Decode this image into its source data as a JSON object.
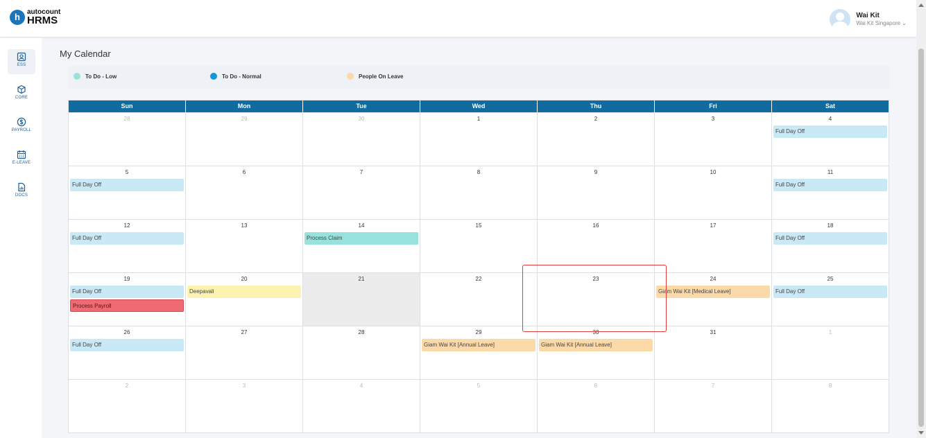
{
  "app": {
    "logo_small": "autocount",
    "logo_big": "HRMS",
    "logo_letter": "h"
  },
  "user": {
    "name": "Wai Kit",
    "company": "Wai Kit Singapore",
    "dropdown_glyph": "⌄"
  },
  "sidebar": {
    "items": [
      {
        "label": "ESS",
        "icon": "ess-icon",
        "active": true
      },
      {
        "label": "CORE",
        "icon": "core-icon",
        "active": false
      },
      {
        "label": "PAYROLL",
        "icon": "payroll-icon",
        "active": false
      },
      {
        "label": "E-LEAVE",
        "icon": "leave-calendar-icon",
        "active": false
      },
      {
        "label": "DOCS",
        "icon": "docs-icon",
        "active": false
      }
    ]
  },
  "page": {
    "title": "My Calendar"
  },
  "legend": [
    {
      "label": "To Do - Low",
      "color": "#97e2dc"
    },
    {
      "label": "To Do - Normal",
      "color": "#1496d6"
    },
    {
      "label": "People On Leave",
      "color": "#fcd9a8"
    }
  ],
  "calendar": {
    "weekdays": [
      "Sun",
      "Mon",
      "Tue",
      "Wed",
      "Thu",
      "Fri",
      "Sat"
    ],
    "weeks": [
      [
        {
          "num": "28",
          "other": true,
          "events": []
        },
        {
          "num": "29",
          "other": true,
          "events": []
        },
        {
          "num": "30",
          "other": true,
          "events": []
        },
        {
          "num": "1",
          "events": []
        },
        {
          "num": "2",
          "events": []
        },
        {
          "num": "3",
          "events": []
        },
        {
          "num": "4",
          "events": [
            {
              "label": "Full Day Off",
              "kind": "off"
            }
          ]
        }
      ],
      [
        {
          "num": "5",
          "events": [
            {
              "label": "Full Day Off",
              "kind": "off"
            }
          ]
        },
        {
          "num": "6",
          "events": []
        },
        {
          "num": "7",
          "events": []
        },
        {
          "num": "8",
          "events": []
        },
        {
          "num": "9",
          "events": []
        },
        {
          "num": "10",
          "events": []
        },
        {
          "num": "11",
          "events": [
            {
              "label": "Full Day Off",
              "kind": "off"
            }
          ]
        }
      ],
      [
        {
          "num": "12",
          "events": [
            {
              "label": "Full Day Off",
              "kind": "off"
            }
          ]
        },
        {
          "num": "13",
          "events": []
        },
        {
          "num": "14",
          "events": [
            {
              "label": "Process Claim",
              "kind": "claim"
            }
          ]
        },
        {
          "num": "15",
          "events": []
        },
        {
          "num": "16",
          "events": []
        },
        {
          "num": "17",
          "events": []
        },
        {
          "num": "18",
          "events": [
            {
              "label": "Full Day Off",
              "kind": "off"
            }
          ]
        }
      ],
      [
        {
          "num": "19",
          "events": [
            {
              "label": "Full Day Off",
              "kind": "off"
            },
            {
              "label": "Process Payroll",
              "kind": "payroll"
            }
          ]
        },
        {
          "num": "20",
          "events": [
            {
              "label": "Deepavali",
              "kind": "holiday"
            }
          ]
        },
        {
          "num": "21",
          "today": true,
          "events": []
        },
        {
          "num": "22",
          "events": []
        },
        {
          "num": "23",
          "events": []
        },
        {
          "num": "24",
          "events": [
            {
              "label": "Giam Wai Kit [Medical Leave]",
              "kind": "leave"
            }
          ]
        },
        {
          "num": "25",
          "events": [
            {
              "label": "Full Day Off",
              "kind": "off"
            }
          ]
        }
      ],
      [
        {
          "num": "26",
          "events": [
            {
              "label": "Full Day Off",
              "kind": "off"
            }
          ]
        },
        {
          "num": "27",
          "events": []
        },
        {
          "num": "28",
          "events": []
        },
        {
          "num": "29",
          "events": [
            {
              "label": "Giam Wai Kit [Annual Leave]",
              "kind": "leave"
            }
          ]
        },
        {
          "num": "30",
          "events": [
            {
              "label": "Giam Wai Kit [Annual Leave]",
              "kind": "leave"
            }
          ]
        },
        {
          "num": "31",
          "events": []
        },
        {
          "num": "1",
          "other": true,
          "events": []
        }
      ],
      [
        {
          "num": "2",
          "other": true,
          "events": []
        },
        {
          "num": "3",
          "other": true,
          "events": []
        },
        {
          "num": "4",
          "other": true,
          "events": []
        },
        {
          "num": "5",
          "other": true,
          "events": []
        },
        {
          "num": "6",
          "other": true,
          "events": []
        },
        {
          "num": "7",
          "other": true,
          "events": []
        },
        {
          "num": "8",
          "other": true,
          "events": []
        }
      ]
    ]
  }
}
